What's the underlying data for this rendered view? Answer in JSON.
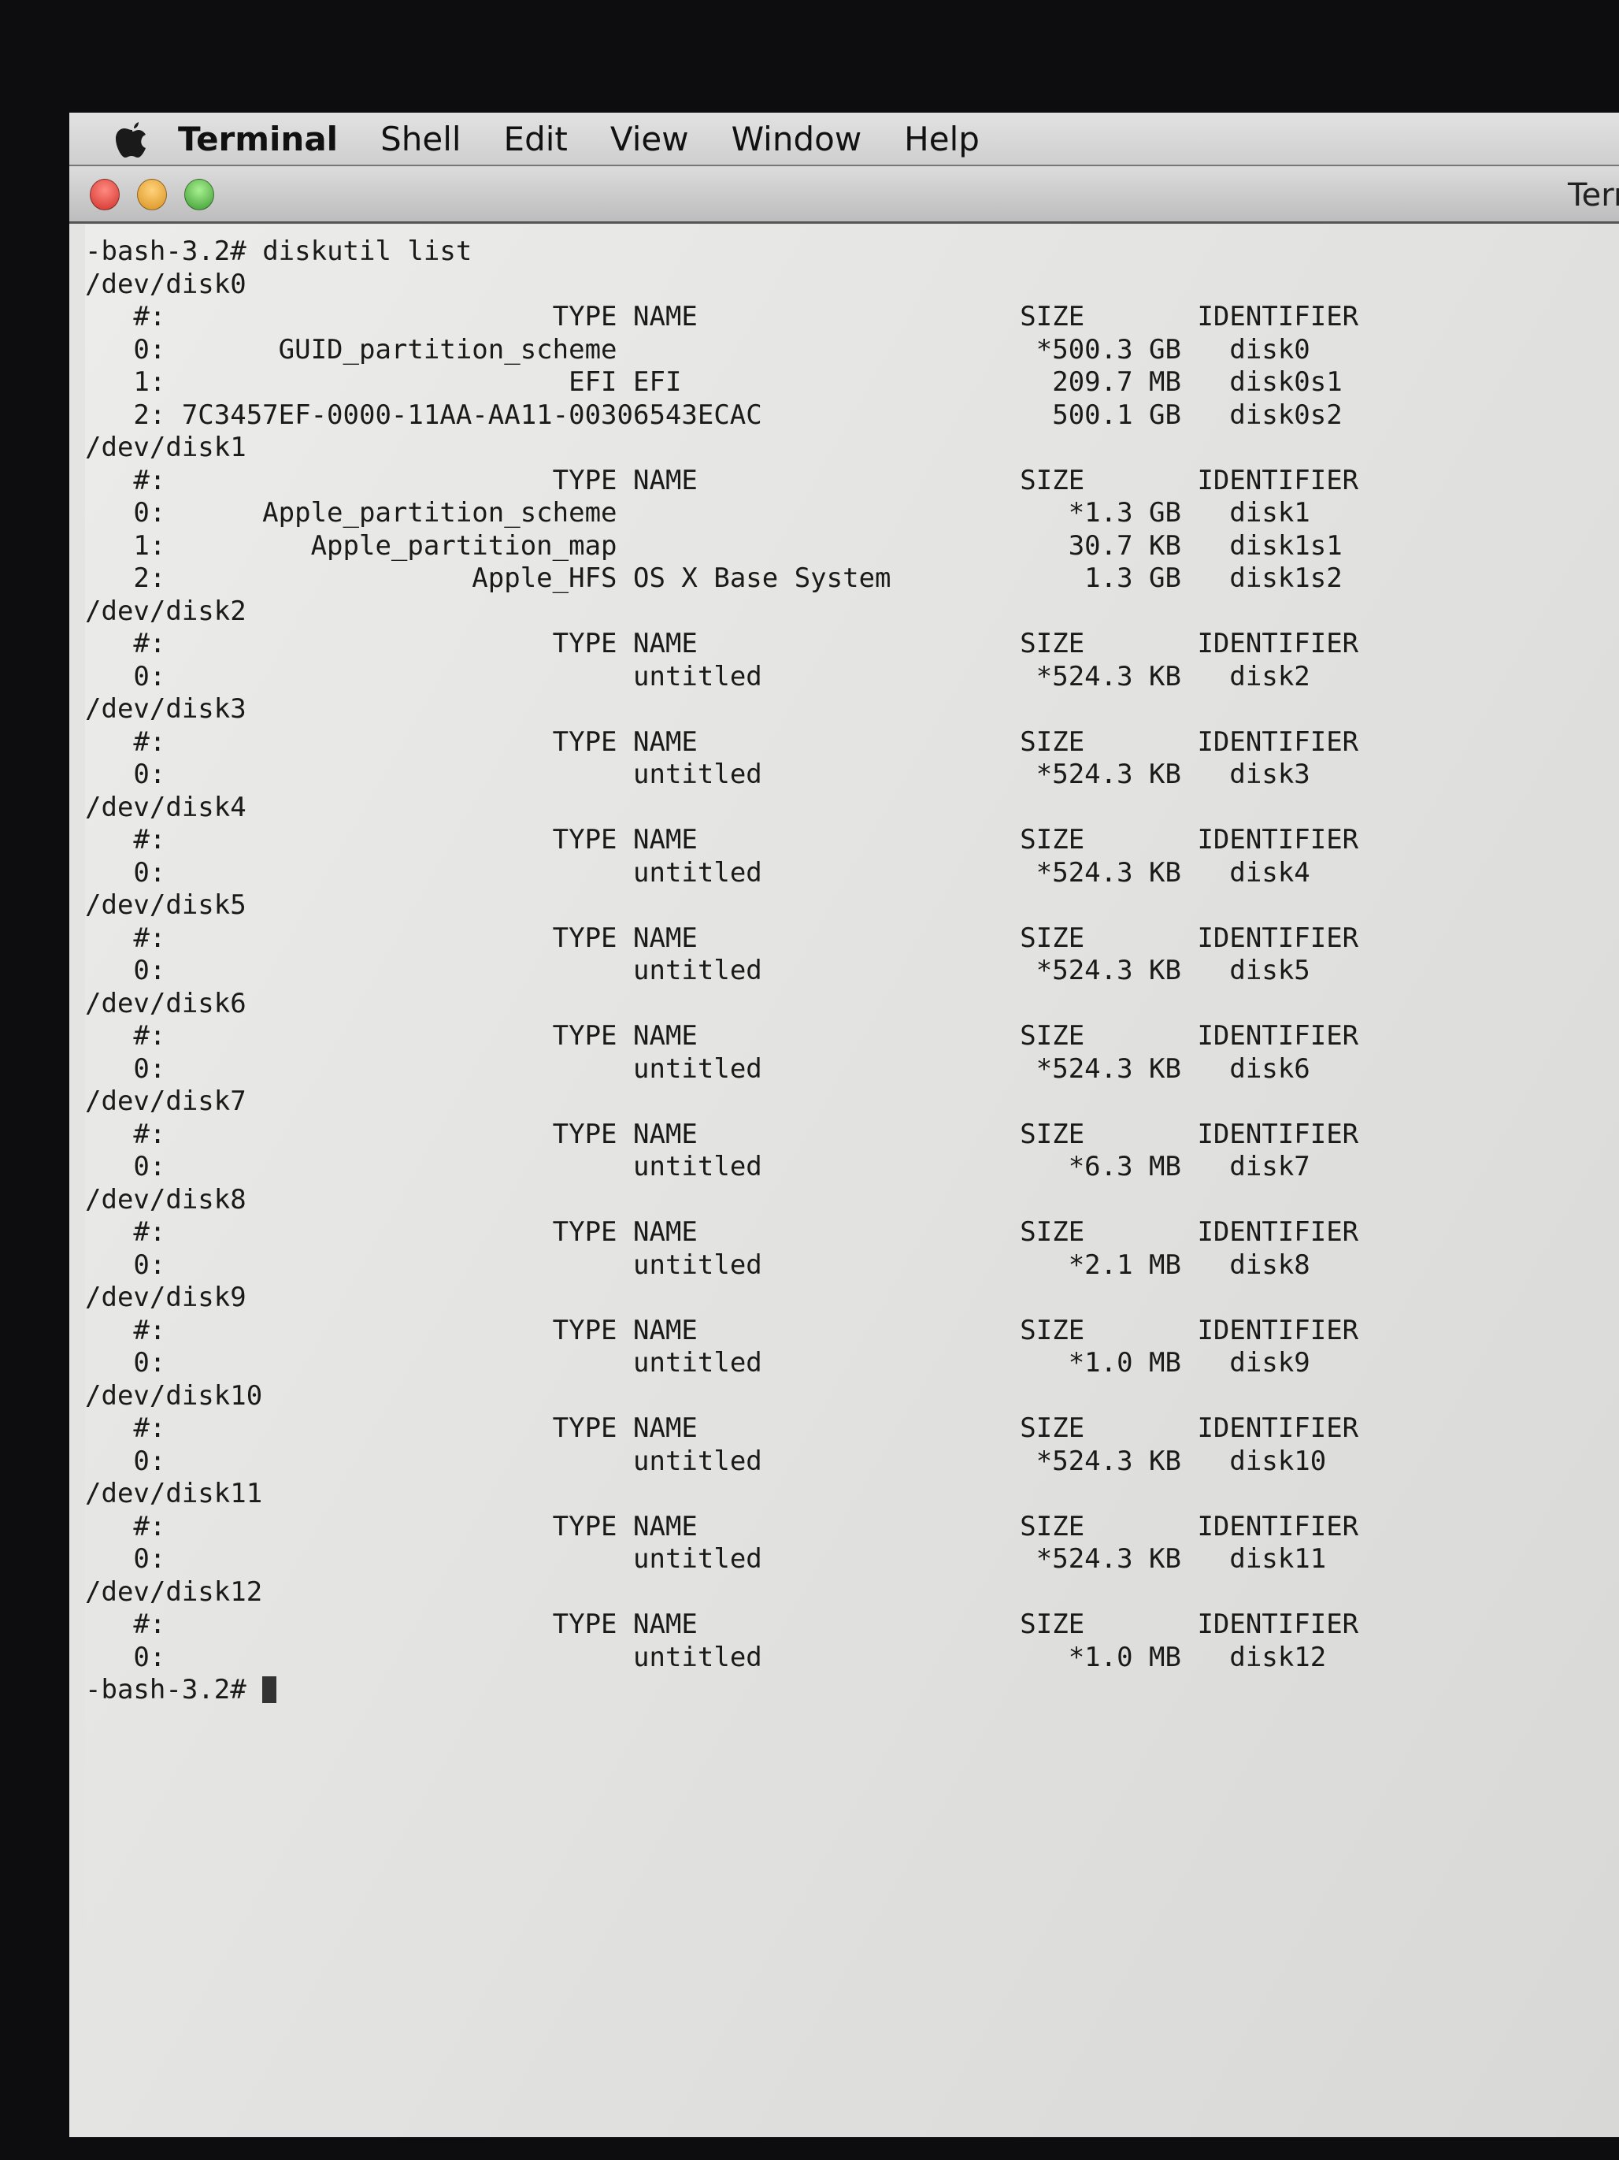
{
  "menubar": {
    "apple_icon": "apple-logo-icon",
    "items": [
      "Terminal",
      "Shell",
      "Edit",
      "View",
      "Window",
      "Help"
    ]
  },
  "window": {
    "title": "Term",
    "traffic_lights": {
      "close": "#e0443e",
      "minimize": "#e0a030",
      "zoom": "#50b040"
    }
  },
  "terminal": {
    "prompt": "-bash-3.2#",
    "command": "diskutil list",
    "headers": {
      "index": "#:",
      "type": "TYPE",
      "name": "NAME",
      "size": "SIZE",
      "identifier": "IDENTIFIER"
    },
    "disks": [
      {
        "device": "/dev/disk0",
        "partitions": [
          {
            "index": "0",
            "type": "GUID_partition_scheme",
            "name": "",
            "size": "*500.3 GB",
            "identifier": "disk0"
          },
          {
            "index": "1",
            "type": "EFI",
            "name": "EFI",
            "size": "209.7 MB",
            "identifier": "disk0s1"
          },
          {
            "index": "2",
            "type": "7C3457EF-0000-11AA-AA11-00306543ECAC",
            "name": "",
            "size": "500.1 GB",
            "identifier": "disk0s2"
          }
        ]
      },
      {
        "device": "/dev/disk1",
        "partitions": [
          {
            "index": "0",
            "type": "Apple_partition_scheme",
            "name": "",
            "size": "*1.3 GB",
            "identifier": "disk1"
          },
          {
            "index": "1",
            "type": "Apple_partition_map",
            "name": "",
            "size": "30.7 KB",
            "identifier": "disk1s1"
          },
          {
            "index": "2",
            "type": "Apple_HFS",
            "name": "OS X Base System",
            "size": "1.3 GB",
            "identifier": "disk1s2"
          }
        ]
      },
      {
        "device": "/dev/disk2",
        "partitions": [
          {
            "index": "0",
            "type": "",
            "name": "untitled",
            "size": "*524.3 KB",
            "identifier": "disk2"
          }
        ]
      },
      {
        "device": "/dev/disk3",
        "partitions": [
          {
            "index": "0",
            "type": "",
            "name": "untitled",
            "size": "*524.3 KB",
            "identifier": "disk3"
          }
        ]
      },
      {
        "device": "/dev/disk4",
        "partitions": [
          {
            "index": "0",
            "type": "",
            "name": "untitled",
            "size": "*524.3 KB",
            "identifier": "disk4"
          }
        ]
      },
      {
        "device": "/dev/disk5",
        "partitions": [
          {
            "index": "0",
            "type": "",
            "name": "untitled",
            "size": "*524.3 KB",
            "identifier": "disk5"
          }
        ]
      },
      {
        "device": "/dev/disk6",
        "partitions": [
          {
            "index": "0",
            "type": "",
            "name": "untitled",
            "size": "*524.3 KB",
            "identifier": "disk6"
          }
        ]
      },
      {
        "device": "/dev/disk7",
        "partitions": [
          {
            "index": "0",
            "type": "",
            "name": "untitled",
            "size": "*6.3 MB",
            "identifier": "disk7"
          }
        ]
      },
      {
        "device": "/dev/disk8",
        "partitions": [
          {
            "index": "0",
            "type": "",
            "name": "untitled",
            "size": "*2.1 MB",
            "identifier": "disk8"
          }
        ]
      },
      {
        "device": "/dev/disk9",
        "partitions": [
          {
            "index": "0",
            "type": "",
            "name": "untitled",
            "size": "*1.0 MB",
            "identifier": "disk9"
          }
        ]
      },
      {
        "device": "/dev/disk10",
        "partitions": [
          {
            "index": "0",
            "type": "",
            "name": "untitled",
            "size": "*524.3 KB",
            "identifier": "disk10"
          }
        ]
      },
      {
        "device": "/dev/disk11",
        "partitions": [
          {
            "index": "0",
            "type": "",
            "name": "untitled",
            "size": "*524.3 KB",
            "identifier": "disk11"
          }
        ]
      },
      {
        "device": "/dev/disk12",
        "partitions": [
          {
            "index": "0",
            "type": "",
            "name": "untitled",
            "size": "*1.0 MB",
            "identifier": "disk12"
          }
        ]
      }
    ]
  }
}
